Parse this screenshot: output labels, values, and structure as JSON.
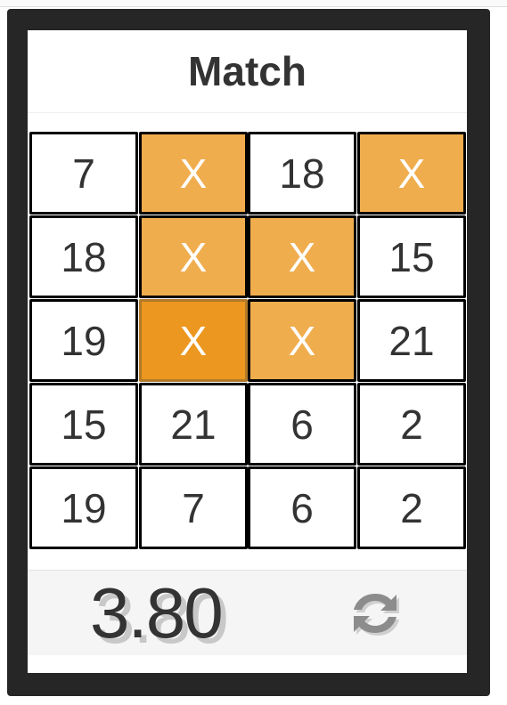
{
  "title": "Match",
  "grid": {
    "rows": [
      [
        {
          "text": "7",
          "state": "plain"
        },
        {
          "text": "X",
          "state": "marked"
        },
        {
          "text": "18",
          "state": "plain"
        },
        {
          "text": "X",
          "state": "marked"
        }
      ],
      [
        {
          "text": "18",
          "state": "plain"
        },
        {
          "text": "X",
          "state": "marked"
        },
        {
          "text": "X",
          "state": "marked"
        },
        {
          "text": "15",
          "state": "plain"
        }
      ],
      [
        {
          "text": "19",
          "state": "plain"
        },
        {
          "text": "X",
          "state": "active"
        },
        {
          "text": "X",
          "state": "marked"
        },
        {
          "text": "21",
          "state": "plain"
        }
      ],
      [
        {
          "text": "15",
          "state": "plain"
        },
        {
          "text": "21",
          "state": "plain"
        },
        {
          "text": "6",
          "state": "plain"
        },
        {
          "text": "2",
          "state": "plain"
        }
      ],
      [
        {
          "text": "19",
          "state": "plain"
        },
        {
          "text": "7",
          "state": "plain"
        },
        {
          "text": "6",
          "state": "plain"
        },
        {
          "text": "2",
          "state": "plain"
        }
      ]
    ]
  },
  "footer": {
    "score": "3.80",
    "refresh_icon": "refresh-icon"
  },
  "colors": {
    "frame": "#262626",
    "marked": "#f0ad4e",
    "active": "#ec971f",
    "icon": "#8c8c8c"
  }
}
